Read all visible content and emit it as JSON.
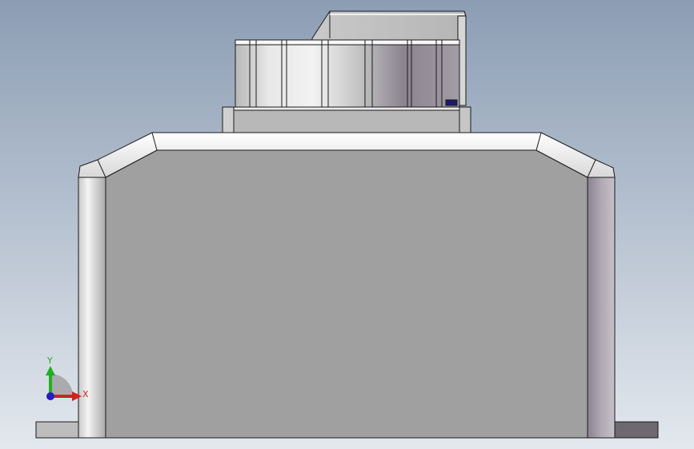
{
  "viewport": {
    "background_top": "#8c9db4",
    "background_bottom": "#e3e8ee"
  },
  "model": {
    "body_color": "#a0a0a0",
    "edge_color": "#1a1a1a",
    "highlight_color": "#ffffff",
    "shadow_color": "#6e6870",
    "accent_color": "#1a1a6e"
  },
  "triad": {
    "x_label": "X",
    "y_label": "Y",
    "x_color": "#d42020",
    "y_color": "#20b020",
    "z_color": "#2020c0"
  }
}
